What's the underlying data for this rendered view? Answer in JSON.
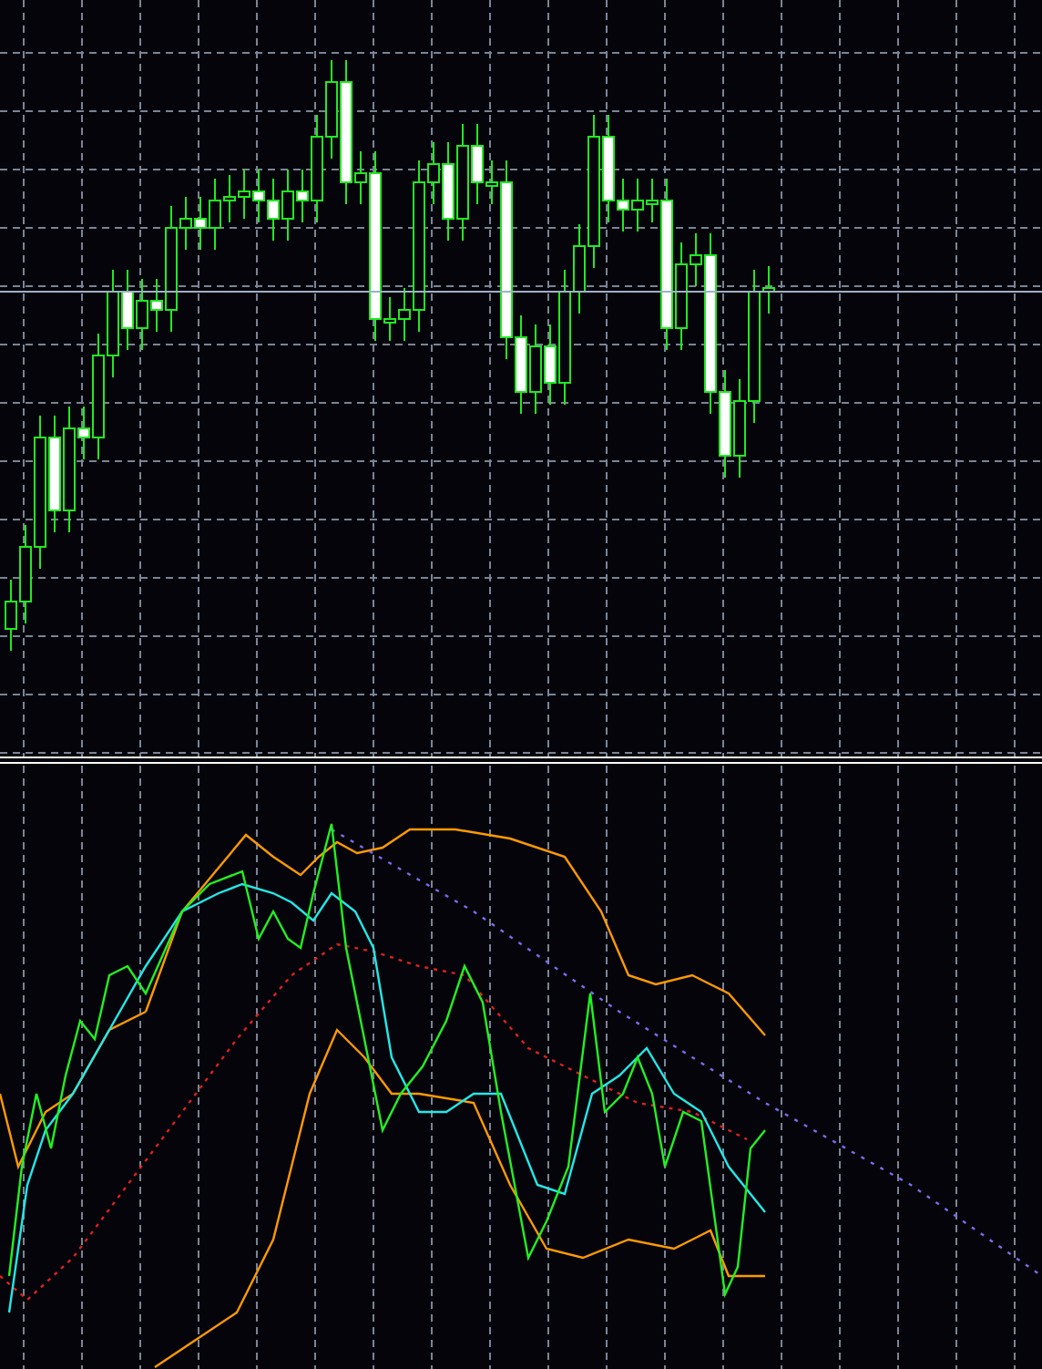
{
  "panes": [
    {
      "kind": "candlestick",
      "current_price_line": true
    },
    {
      "kind": "oscillator"
    }
  ]
}
